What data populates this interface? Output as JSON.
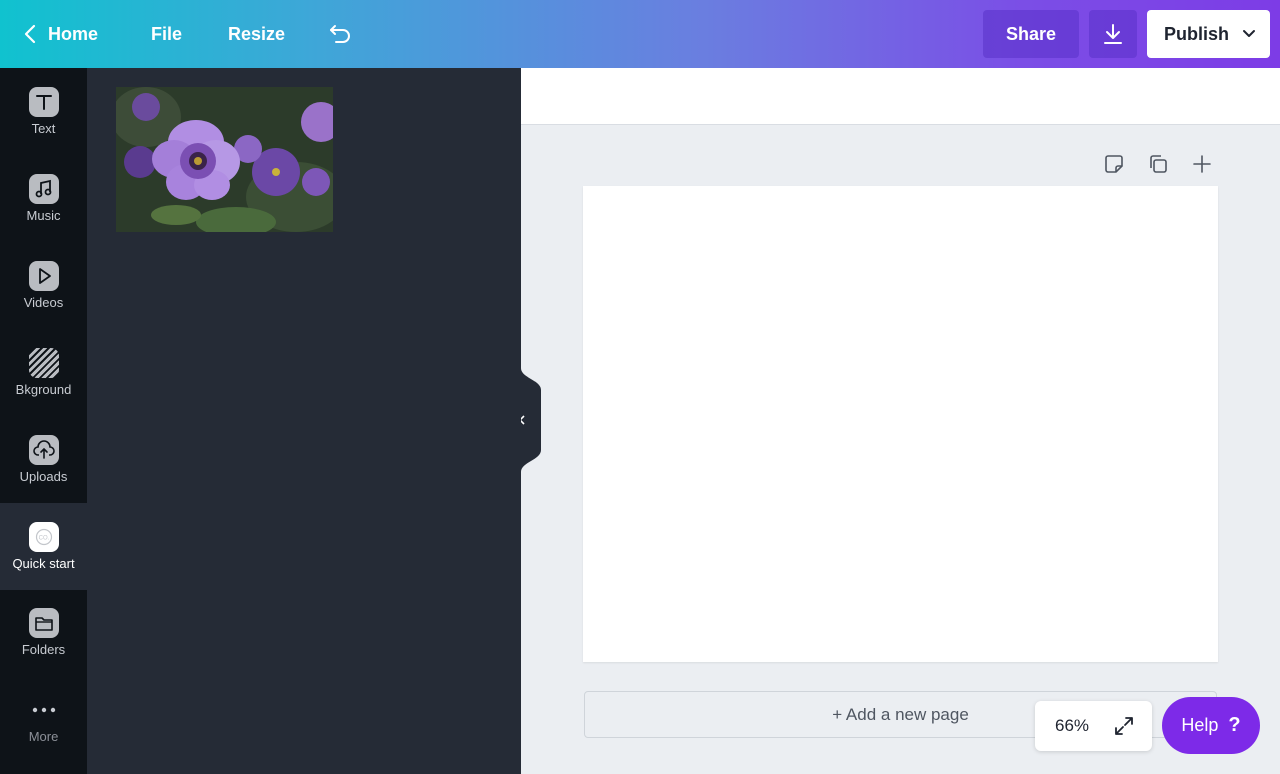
{
  "topbar": {
    "home_label": "Home",
    "file_label": "File",
    "resize_label": "Resize",
    "share_label": "Share",
    "publish_label": "Publish"
  },
  "sidebar": {
    "items": [
      {
        "label": "Text",
        "icon": "text-icon"
      },
      {
        "label": "Music",
        "icon": "music-icon"
      },
      {
        "label": "Videos",
        "icon": "video-icon"
      },
      {
        "label": "Bkground",
        "icon": "background-icon"
      },
      {
        "label": "Uploads",
        "icon": "upload-icon"
      },
      {
        "label": "Quick start",
        "icon": "quick-start-icon"
      },
      {
        "label": "Folders",
        "icon": "folder-icon"
      },
      {
        "label": "More",
        "icon": "more-icon"
      }
    ],
    "active": "Quick start"
  },
  "workspace": {
    "add_page_label": "+ Add a new page",
    "zoom": "66%"
  },
  "help": {
    "label": "Help",
    "glyph": "?"
  },
  "colors": {
    "accent": "#7d2ae8",
    "sidebar_bg": "#0e1318",
    "panel_bg": "#252b36"
  }
}
